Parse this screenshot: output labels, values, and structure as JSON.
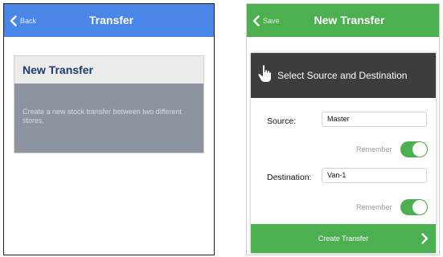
{
  "left": {
    "nav": {
      "back_label": "Back",
      "title": "Transfer"
    },
    "card": {
      "title": "New Transfer",
      "description": "Create a new stock transfer between two different stores."
    }
  },
  "right": {
    "nav": {
      "back_label": "Save",
      "title": "New Transfer"
    },
    "dialog": {
      "title": "Select Source and Destination",
      "source": {
        "label": "Source:",
        "value": "Master",
        "remember_label": "Remember",
        "remember_on": true
      },
      "destination": {
        "label": "Destination:",
        "value": "Van-1",
        "remember_label": "Remember",
        "remember_on": true
      },
      "submit_label": "Create Transfer"
    }
  },
  "colors": {
    "blue_header": "#4a86e8",
    "green_header": "#4caf50",
    "dark_header": "#3d3d3d",
    "card_body": "#8c949f"
  },
  "icons": [
    "chevron-left-icon",
    "hand-pointer-icon",
    "chevron-right-icon"
  ]
}
